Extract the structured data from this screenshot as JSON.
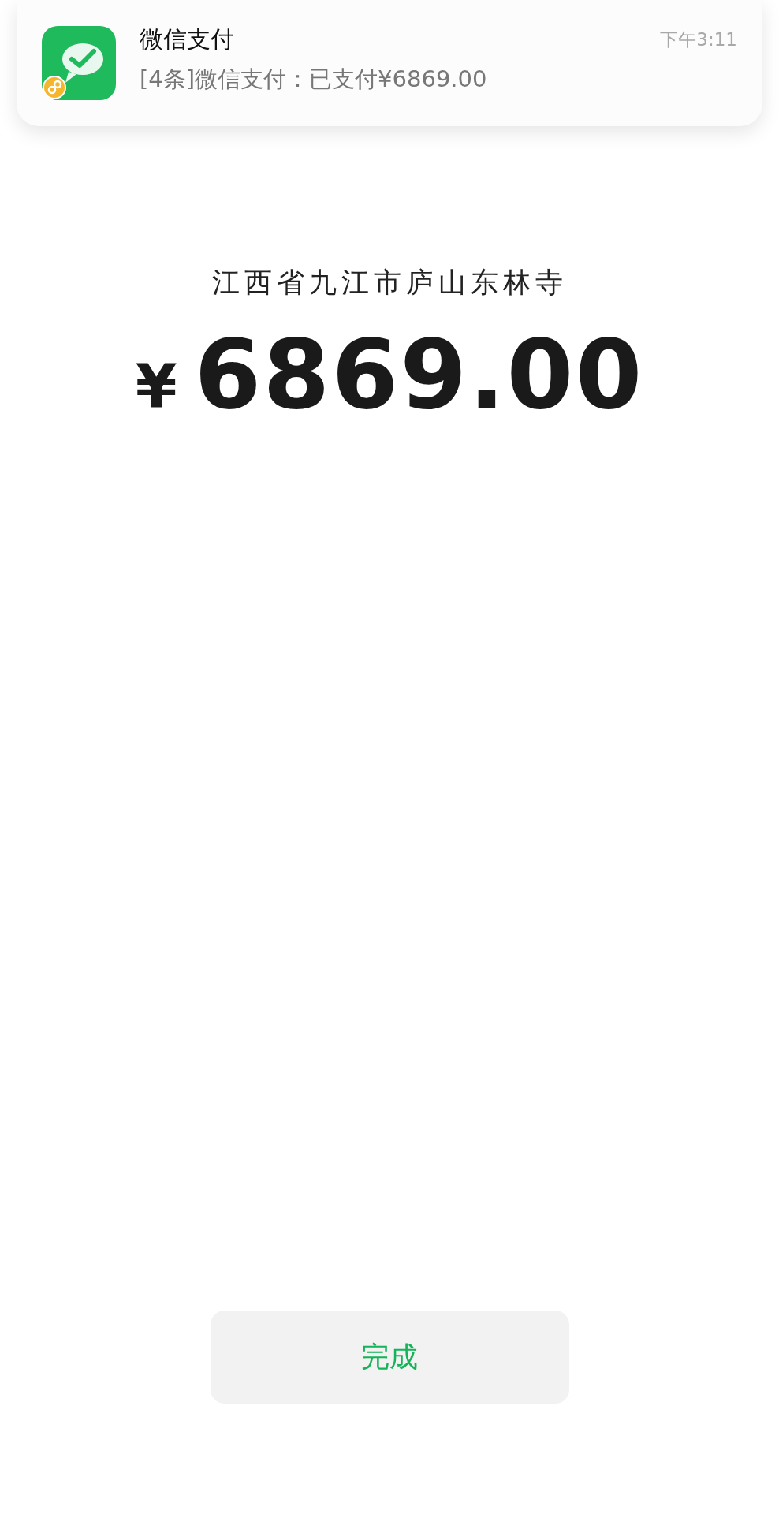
{
  "notification": {
    "app": "微信支付",
    "time": "下午3:11",
    "message": "[4条]微信支付：已支付¥6869.00"
  },
  "payment": {
    "merchant": "江西省九江市庐山东林寺",
    "currency": "¥",
    "amount": "6869.00"
  },
  "buttons": [
    {
      "label": "完成"
    }
  ]
}
